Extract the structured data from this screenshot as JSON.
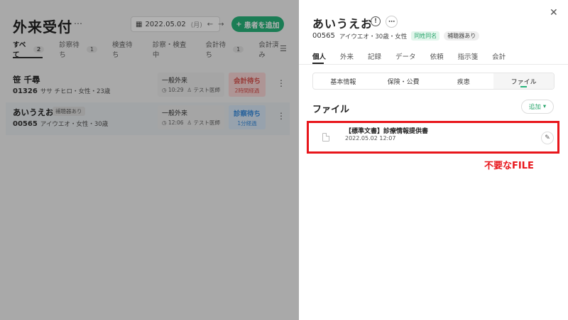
{
  "background": {
    "title": "外来受付",
    "title_menu": "⋯",
    "date": "2022.05.02",
    "day_of_week": "(月)",
    "add_patient": "患者を追加",
    "tabs": [
      {
        "label": "すべて",
        "count": "2"
      },
      {
        "label": "診察待ち",
        "count": "1"
      },
      {
        "label": "検査待ち",
        "count": ""
      },
      {
        "label": "診察・検査中",
        "count": ""
      },
      {
        "label": "会計待ち",
        "count": "1"
      },
      {
        "label": "会計済み",
        "count": ""
      }
    ],
    "rows": [
      {
        "name": "笹 千尋",
        "id": "01326",
        "detail": "ササ チヒロ・女性・23歳",
        "visit_type": "一般外来",
        "time": "10:29",
        "doctor": "テスト医師",
        "status": "会計待ち",
        "elapsed": "2時間経過"
      },
      {
        "name": "あいうえお",
        "badge": "補聴器あり",
        "id": "00565",
        "detail": "アイウエオ・女性・30歳",
        "visit_type": "一般外来",
        "time": "12:06",
        "doctor": "テスト医師",
        "status": "診察待ち",
        "elapsed": "1分経過"
      }
    ]
  },
  "panel": {
    "name": "あいうえお",
    "patient_id": "00565",
    "detail": "アイウエオ・30歳・女性",
    "chip_same_name": "同姓同名",
    "chip_hearing": "補聴器あり",
    "tabs": [
      "個人",
      "外来",
      "記録",
      "データ",
      "依頼",
      "指示箋",
      "会計"
    ],
    "segments": [
      "基本情報",
      "保険・公費",
      "疾患",
      "ファイル"
    ],
    "section_title": "ファイル",
    "add_label": "追加",
    "file": {
      "name": "【標準文書】診療情報提供書",
      "date": "2022.05.02 12:07"
    }
  },
  "annotation": "不要なFILE",
  "colors": {
    "accent": "#27b47a",
    "highlight": "#e8161b"
  }
}
